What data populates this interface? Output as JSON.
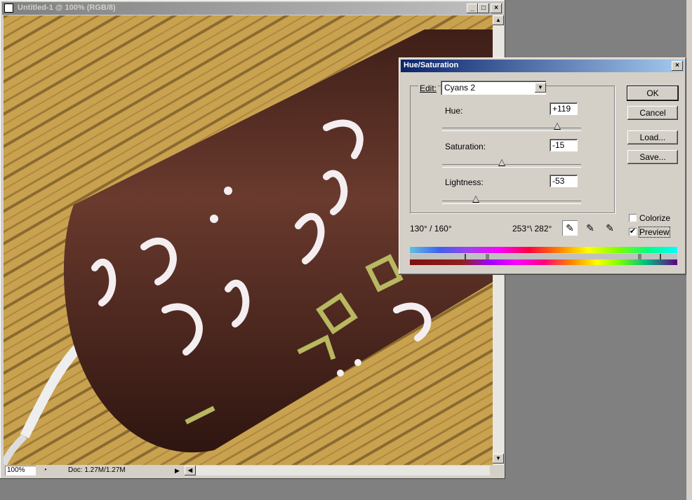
{
  "document": {
    "title": "Untitled-1 @ 100% (RGB/8)",
    "controls": {
      "minimize": "_",
      "maximize": "□",
      "close": "×"
    },
    "status": {
      "zoom": "100%",
      "doc_info": "Doc: 1.27M/1.27M"
    }
  },
  "dialog": {
    "title": "Hue/Saturation",
    "close": "×",
    "edit_label": "Edit:",
    "edit_value": "Cyans 2",
    "hue": {
      "label": "Hue:",
      "value": "+119",
      "level": 0.83
    },
    "saturation": {
      "label": "Saturation:",
      "value": "-15",
      "level": 0.43
    },
    "lightness": {
      "label": "Lightness:",
      "value": "-53",
      "level": 0.24
    },
    "range_left": "130° / 160°",
    "range_right": "253°\\ 282°",
    "buttons": {
      "ok": "OK",
      "cancel": "Cancel",
      "load": "Load...",
      "save": "Save..."
    },
    "colorize": {
      "label": "Colorize",
      "checked": false
    },
    "preview": {
      "label": "Preview",
      "checked": true,
      "mark": "✔"
    }
  },
  "colors": {
    "title_start": "#0a246a",
    "title_end": "#a6caf0",
    "chocolate": "#5a3026",
    "wood": "#c8a050"
  }
}
